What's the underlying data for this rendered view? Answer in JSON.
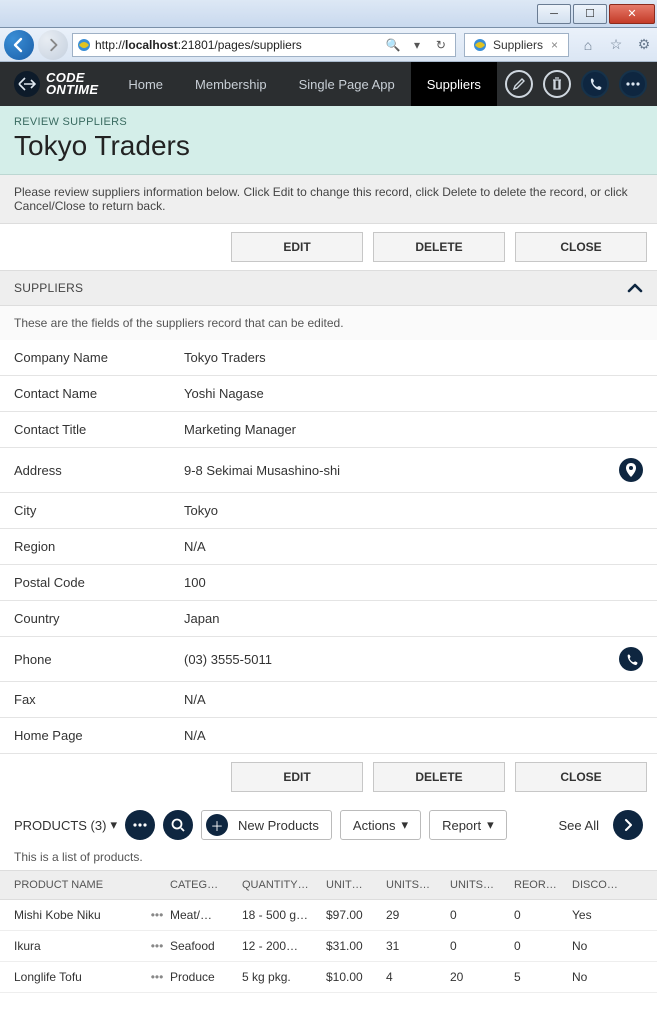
{
  "browser": {
    "url_prefix": "http://",
    "url_host": "localhost",
    "url_rest": ":21801/pages/suppliers",
    "tab_title": "Suppliers"
  },
  "nav": {
    "logo_line1": "CODE",
    "logo_line2": "ONTIME",
    "items": [
      "Home",
      "Membership",
      "Single Page App",
      "Suppliers"
    ],
    "active_index": 3
  },
  "header": {
    "kicker": "REVIEW SUPPLIERS",
    "title": "Tokyo Traders"
  },
  "notice": "Please review suppliers information below. Click Edit to change this record, click Delete to delete the record, or click Cancel/Close to return back.",
  "buttons": {
    "edit": "EDIT",
    "delete": "DELETE",
    "close": "CLOSE"
  },
  "section": {
    "title": "SUPPLIERS",
    "desc": "These are the fields of the suppliers record that can be edited."
  },
  "fields": [
    {
      "label": "Company Name",
      "value": "Tokyo Traders"
    },
    {
      "label": "Contact Name",
      "value": "Yoshi Nagase"
    },
    {
      "label": "Contact Title",
      "value": "Marketing Manager"
    },
    {
      "label": "Address",
      "value": "9-8 Sekimai Musashino-shi",
      "icon": "map-pin"
    },
    {
      "label": "City",
      "value": "Tokyo"
    },
    {
      "label": "Region",
      "value": "N/A"
    },
    {
      "label": "Postal Code",
      "value": "100"
    },
    {
      "label": "Country",
      "value": "Japan"
    },
    {
      "label": "Phone",
      "value": "(03) 3555-5011",
      "icon": "phone"
    },
    {
      "label": "Fax",
      "value": "N/A"
    },
    {
      "label": "Home Page",
      "value": "N/A"
    }
  ],
  "products": {
    "title": "PRODUCTS (3)",
    "new_label": "New Products",
    "actions_label": "Actions",
    "report_label": "Report",
    "see_all": "See All",
    "desc": "This is a list of products.",
    "columns": [
      "PRODUCT NAME",
      "CATEG…",
      "QUANTITY…",
      "UNIT…",
      "UNITS…",
      "UNITS…",
      "REOR…",
      "DISCO…"
    ],
    "rows": [
      {
        "name": "Mishi Kobe Niku",
        "cat": "Meat/…",
        "qty": "18 - 500 g…",
        "price": "$97.00",
        "stock": "29",
        "order": "0",
        "reord": "0",
        "disc": "Yes"
      },
      {
        "name": "Ikura",
        "cat": "Seafood",
        "qty": "12 - 200…",
        "price": "$31.00",
        "stock": "31",
        "order": "0",
        "reord": "0",
        "disc": "No"
      },
      {
        "name": "Longlife Tofu",
        "cat": "Produce",
        "qty": "5 kg pkg.",
        "price": "$10.00",
        "stock": "4",
        "order": "20",
        "reord": "5",
        "disc": "No"
      }
    ]
  }
}
